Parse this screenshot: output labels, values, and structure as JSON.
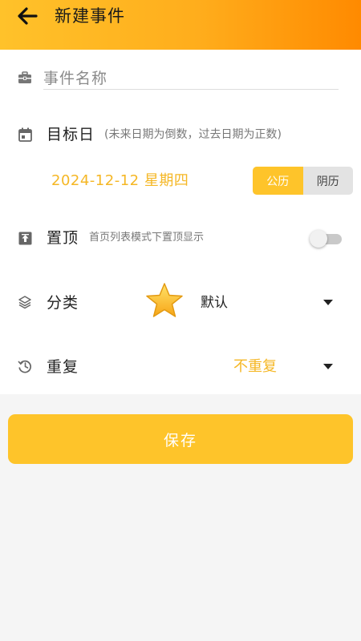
{
  "header": {
    "title": "新建事件",
    "back_icon": "arrow-left-icon"
  },
  "event_name": {
    "placeholder": "事件名称",
    "value": "",
    "icon": "briefcase-icon"
  },
  "target_date": {
    "label": "目标日",
    "hint": "(未来日期为倒数，过去日期为正数)",
    "icon": "calendar-icon",
    "value": "2024-12-12 星期四",
    "calendar_options": [
      "公历",
      "阴历"
    ],
    "selected_calendar": "公历"
  },
  "pin_top": {
    "label": "置顶",
    "hint": "首页列表模式下置顶显示",
    "icon": "pin-top-icon",
    "enabled": false
  },
  "category": {
    "label": "分类",
    "icon": "layers-icon",
    "emoji_icon": "star-icon",
    "value": "默认"
  },
  "repeat": {
    "label": "重复",
    "icon": "history-icon",
    "value": "不重复"
  },
  "save_button": {
    "label": "保存"
  },
  "colors": {
    "accent": "#fec42a",
    "header_gradient_start": "#ffc22a",
    "header_gradient_end": "#ff8a00",
    "date_text": "#f5b725"
  }
}
